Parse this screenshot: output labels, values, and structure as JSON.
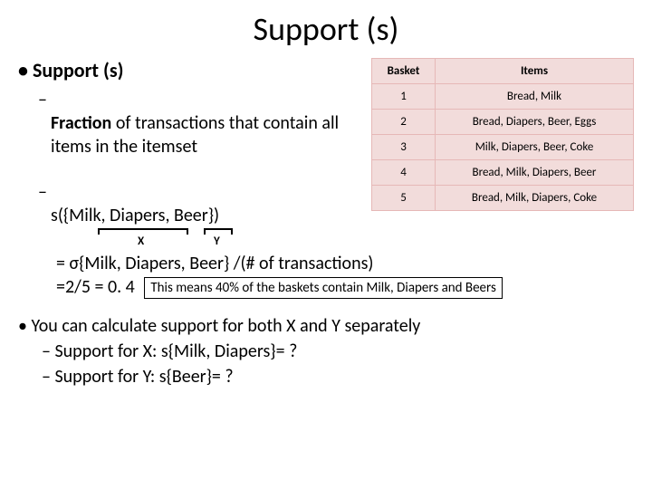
{
  "title": "Support  (s)",
  "heading": "Support (s)",
  "definition_bold": "Fraction",
  "definition_rest": " of transactions that contain all items in the itemset",
  "formula_s": "s({Milk, Diapers, Beer})",
  "label_x": "X",
  "label_y": "Y",
  "formula_line1": "= σ{Milk, Diapers, Beer} /(# of transactions)",
  "formula_line2a": "=2/5 = 0. 4",
  "note": "This means 40% of the baskets contain Milk, Diapers and Beers",
  "table": {
    "headers": [
      "Basket",
      "Items"
    ],
    "rows": [
      [
        "1",
        "Bread, Milk"
      ],
      [
        "2",
        "Bread, Diapers, Beer, Eggs"
      ],
      [
        "3",
        "Milk, Diapers, Beer, Coke"
      ],
      [
        "4",
        "Bread, Milk, Diapers, Beer"
      ],
      [
        "5",
        "Bread, Milk, Diapers, Coke"
      ]
    ]
  },
  "lower": {
    "main": "You can calculate support for both X and Y separately",
    "sub1": "Support for X: s{Milk, Diapers}= ?",
    "sub2": "Support for Y:  s{Beer}= ?"
  }
}
